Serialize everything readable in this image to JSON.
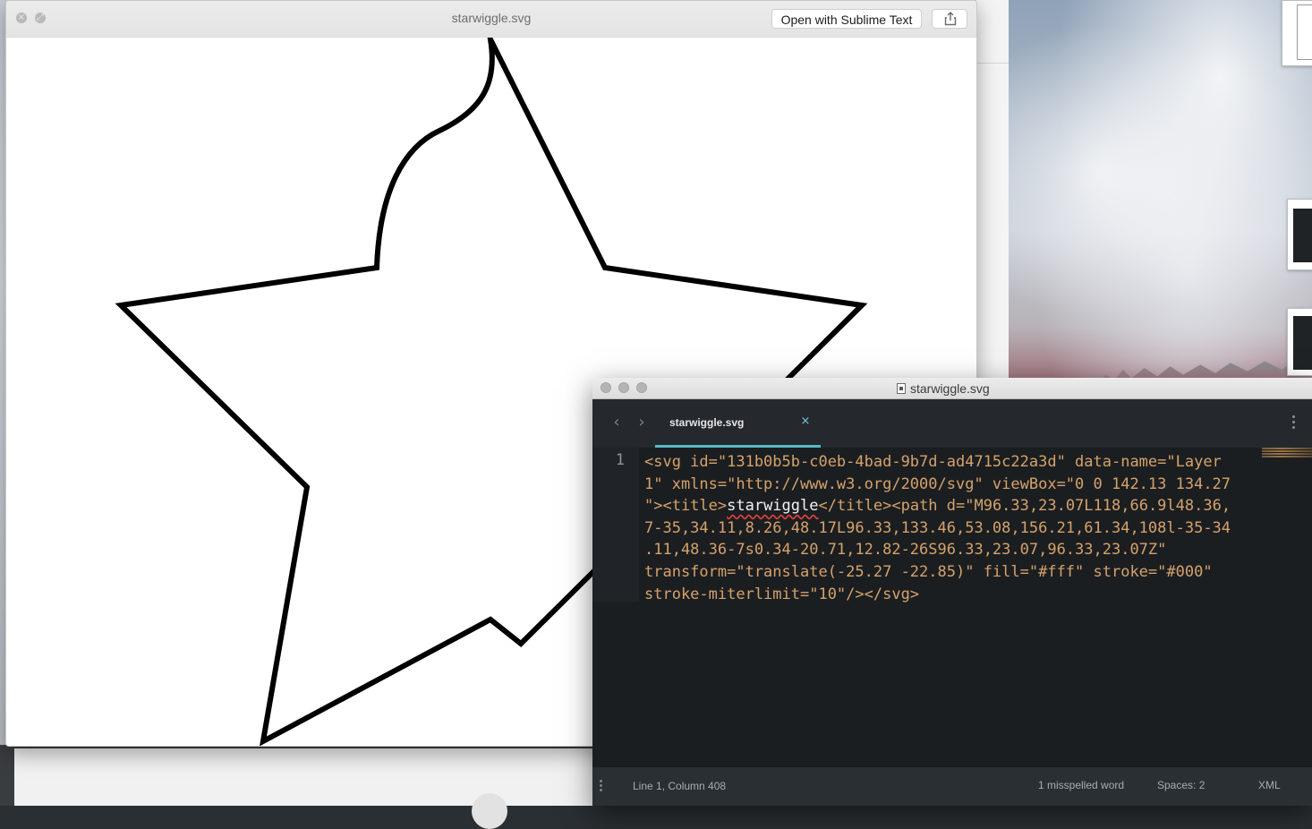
{
  "quicklook": {
    "title": "starwiggle.svg",
    "open_button_label": "Open with Sublime Text",
    "icons": {
      "close": "close-icon",
      "fullscreen": "fullscreen-icon",
      "share": "share-icon"
    },
    "preview": {
      "stroke_color": "#000000",
      "fill_color": "#ffffff"
    }
  },
  "sublime": {
    "window_title": "starwiggle.svg",
    "tab": {
      "label": "starwiggle.svg",
      "close_glyph": "×",
      "accent_color": "#58b9c9"
    },
    "nav": {
      "back_glyph": "‹",
      "forward_glyph": "›"
    },
    "editor": {
      "line_number": "1",
      "code_line_1": "<svg id=\"131b0b5b-c0eb-4bad-9b7d-ad4715c22a3d\" data-name=\"Layer",
      "code_line_2": "1\" xmlns=\"http://www.w3.org/2000/svg\" viewBox=\"0 0 142.13 134.27",
      "code_line_3_a": "\"><title>",
      "code_line_3_word": "starwiggle",
      "code_line_3_b": "</title><path d=\"M96.33,23.07L118,66.9l48.36,",
      "code_line_4": "7-35,34.11,8.26,48.17L96.33,133.46,53.08,156.21,61.34,108l-35-34",
      "code_line_5": ".11,48.36-7s0.34-20.71,12.82-26S96.33,23.07,96.33,23.07Z\"",
      "code_line_6": "transform=\"translate(-25.27 -22.85)\" fill=\"#fff\" stroke=\"#000\"",
      "code_line_7": "stroke-miterlimit=\"10\"/></svg>",
      "tag_color": "#d6a26a"
    },
    "status": {
      "position": "Line 1, Column 408",
      "spelling": "1 misspelled word",
      "indentation": "Spaces: 2",
      "syntax": "XML"
    }
  }
}
